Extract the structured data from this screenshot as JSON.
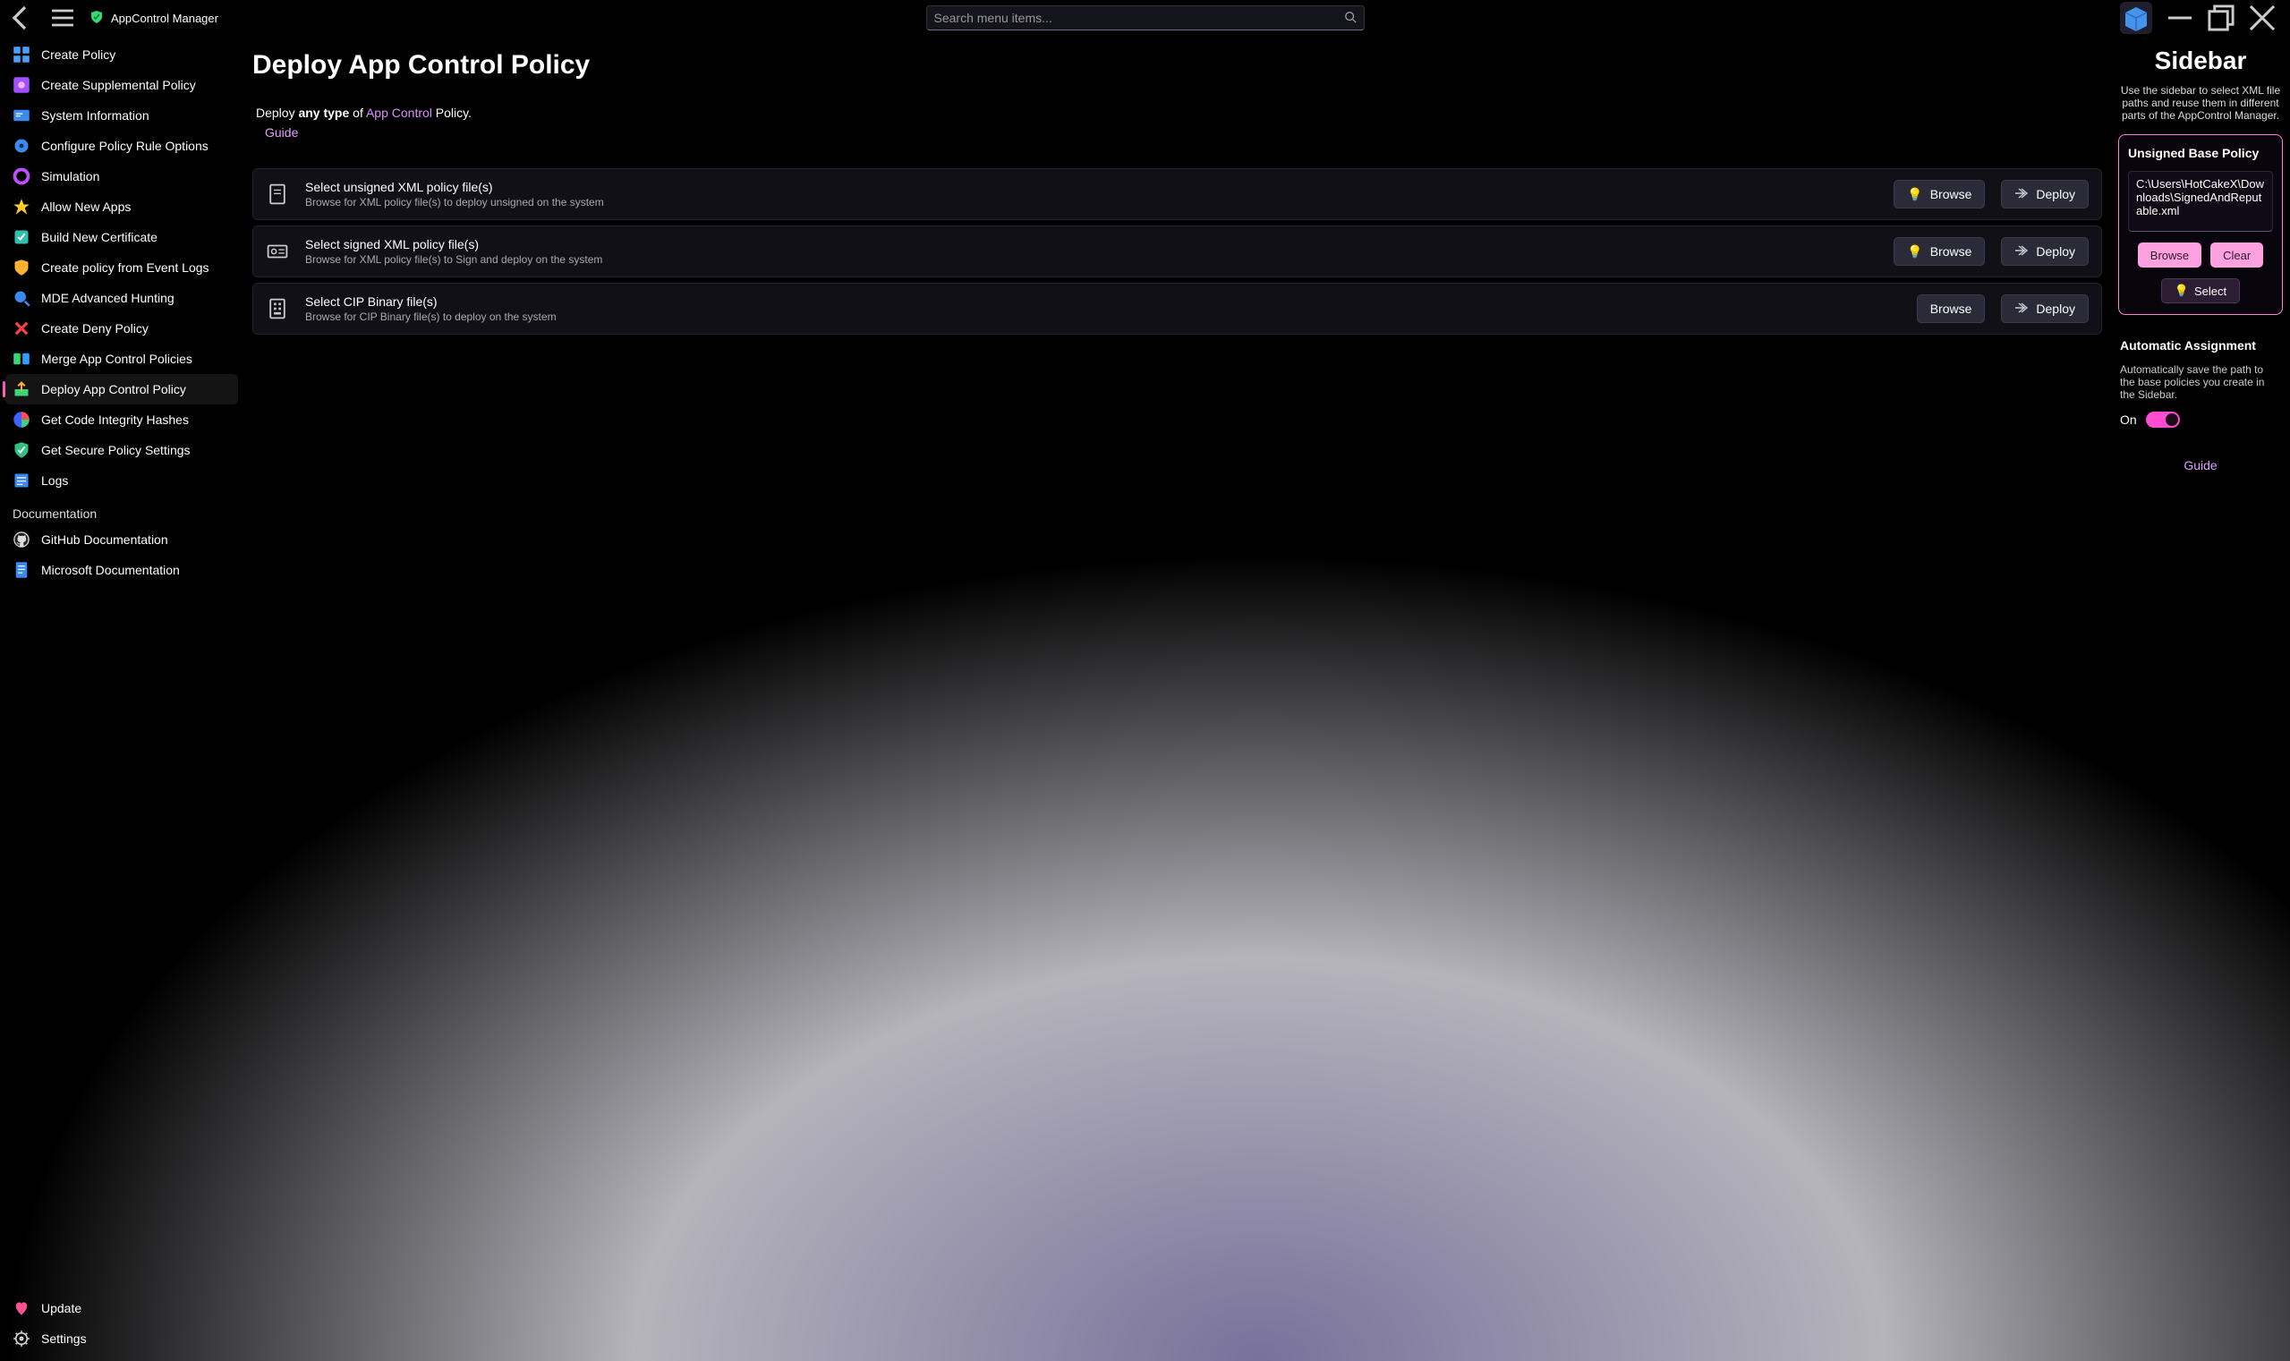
{
  "app": {
    "title": "AppControl Manager"
  },
  "search": {
    "placeholder": "Search menu items..."
  },
  "nav": {
    "items": [
      {
        "label": "Create Policy",
        "icon": "grid-blue"
      },
      {
        "label": "Create Supplemental Policy",
        "icon": "square-purple"
      },
      {
        "label": "System Information",
        "icon": "cert-blue"
      },
      {
        "label": "Configure Policy Rule Options",
        "icon": "gear-blue"
      },
      {
        "label": "Simulation",
        "icon": "ring-purple"
      },
      {
        "label": "Allow New Apps",
        "icon": "star-yellow"
      },
      {
        "label": "Build New Certificate",
        "icon": "badge-teal"
      },
      {
        "label": "Create policy from Event Logs",
        "icon": "shield-yellow"
      },
      {
        "label": "MDE Advanced Hunting",
        "icon": "search-blue"
      },
      {
        "label": "Create Deny Policy",
        "icon": "x-red"
      },
      {
        "label": "Merge App Control Policies",
        "icon": "merge-green"
      },
      {
        "label": "Deploy App Control Policy",
        "icon": "deploy-green",
        "active": true
      },
      {
        "label": "Get Code Integrity Hashes",
        "icon": "pie-multi"
      },
      {
        "label": "Get Secure Policy Settings",
        "icon": "shield-check"
      },
      {
        "label": "Logs",
        "icon": "list-blue"
      }
    ],
    "section_label": "Documentation",
    "docs": [
      {
        "label": "GitHub Documentation",
        "icon": "github"
      },
      {
        "label": "Microsoft Documentation",
        "icon": "doc-blue"
      }
    ],
    "footer": [
      {
        "label": "Update",
        "icon": "heart-pink"
      },
      {
        "label": "Settings",
        "icon": "gear-gray"
      }
    ]
  },
  "main": {
    "title": "Deploy App Control Policy",
    "desc_prefix": "Deploy ",
    "desc_bold": "any type",
    "desc_of": " of ",
    "desc_link": "App Control",
    "desc_suffix": " Policy.",
    "guide": "Guide",
    "cards": [
      {
        "title": "Select unsigned XML policy file(s)",
        "sub": "Browse for XML policy file(s) to deploy unsigned on the system",
        "browse": "Browse",
        "deploy": "Deploy",
        "bulb": true
      },
      {
        "title": "Select signed XML policy file(s)",
        "sub": "Browse for XML policy file(s) to Sign and deploy on the system",
        "browse": "Browse",
        "deploy": "Deploy",
        "bulb": true
      },
      {
        "title": "Select CIP Binary file(s)",
        "sub": "Browse for CIP Binary file(s) to deploy on the system",
        "browse": "Browse",
        "deploy": "Deploy",
        "bulb": false
      }
    ]
  },
  "sidebar": {
    "title": "Sidebar",
    "desc": "Use the sidebar to select XML file paths and reuse them in different parts of the AppControl Manager.",
    "panel_label": "Unsigned Base Policy",
    "path": "C:\\Users\\HotCakeX\\Downloads\\SignedAndReputable.xml",
    "browse": "Browse",
    "clear": "Clear",
    "select": "Select",
    "auto_label": "Automatic Assignment",
    "auto_desc": "Automatically save the path to the base policies you create in the Sidebar.",
    "toggle_text": "On",
    "guide": "Guide"
  }
}
